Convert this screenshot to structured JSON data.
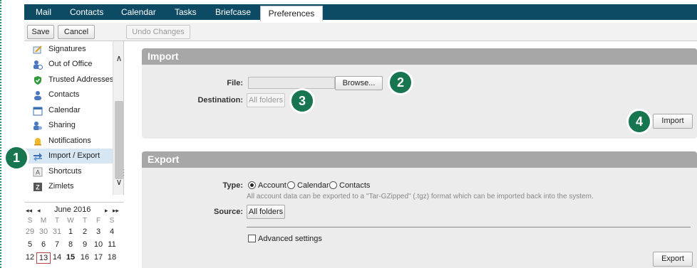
{
  "nav": {
    "tabs": [
      {
        "label": "Mail"
      },
      {
        "label": "Contacts"
      },
      {
        "label": "Calendar"
      },
      {
        "label": "Tasks"
      },
      {
        "label": "Briefcase"
      },
      {
        "label": "Preferences",
        "active": true
      }
    ]
  },
  "toolbar": {
    "save": "Save",
    "cancel": "Cancel",
    "undo": "Undo Changes"
  },
  "sidebar": {
    "items": [
      {
        "label": "Signatures",
        "icon": "signature-icon"
      },
      {
        "label": "Out of Office",
        "icon": "out-of-office-icon"
      },
      {
        "label": "Trusted Addresses",
        "icon": "shield-icon"
      },
      {
        "label": "Contacts",
        "icon": "person-icon"
      },
      {
        "label": "Calendar",
        "icon": "calendar-icon"
      },
      {
        "label": "Sharing",
        "icon": "sharing-icon"
      },
      {
        "label": "Notifications",
        "icon": "bell-icon"
      },
      {
        "label": "Import / Export",
        "icon": "import-export-icon",
        "selected": true
      },
      {
        "label": "Shortcuts",
        "icon": "keyboard-shortcut-icon"
      },
      {
        "label": "Zimlets",
        "icon": "zimlet-icon"
      }
    ]
  },
  "minical": {
    "month": "June 2016",
    "nav": {
      "prev_year": "◂◂",
      "prev": "◂",
      "next": "▸",
      "next_year": "▸▸"
    },
    "dow": [
      "S",
      "M",
      "T",
      "W",
      "T",
      "F",
      "S"
    ],
    "weeks": [
      [
        "29",
        "30",
        "31",
        "1",
        "2",
        "3",
        "4"
      ],
      [
        "5",
        "6",
        "7",
        "8",
        "9",
        "10",
        "11"
      ],
      [
        "12",
        "13",
        "14",
        "15",
        "16",
        "17",
        "18"
      ]
    ],
    "today": "13"
  },
  "import": {
    "title": "Import",
    "file_label": "File:",
    "browse": "Browse...",
    "destination_label": "Destination:",
    "destination_value": "All folders",
    "import_button": "Import"
  },
  "export": {
    "title": "Export",
    "type_label": "Type:",
    "types": [
      "Account",
      "Calendar",
      "Contacts"
    ],
    "selected_type": "Account",
    "hint": "All account data can be exported to a \"Tar-GZipped\" (.tgz) format which can be imported back into the system.",
    "source_label": "Source:",
    "source_value": "All folders",
    "advanced": "Advanced settings",
    "export_button": "Export"
  },
  "callouts": [
    "1",
    "2",
    "3",
    "4"
  ],
  "colors": {
    "nav": "#0d4a63",
    "section_header": "#a7a7a7",
    "callout": "#17764f",
    "selected_item": "#d6e6f2"
  }
}
